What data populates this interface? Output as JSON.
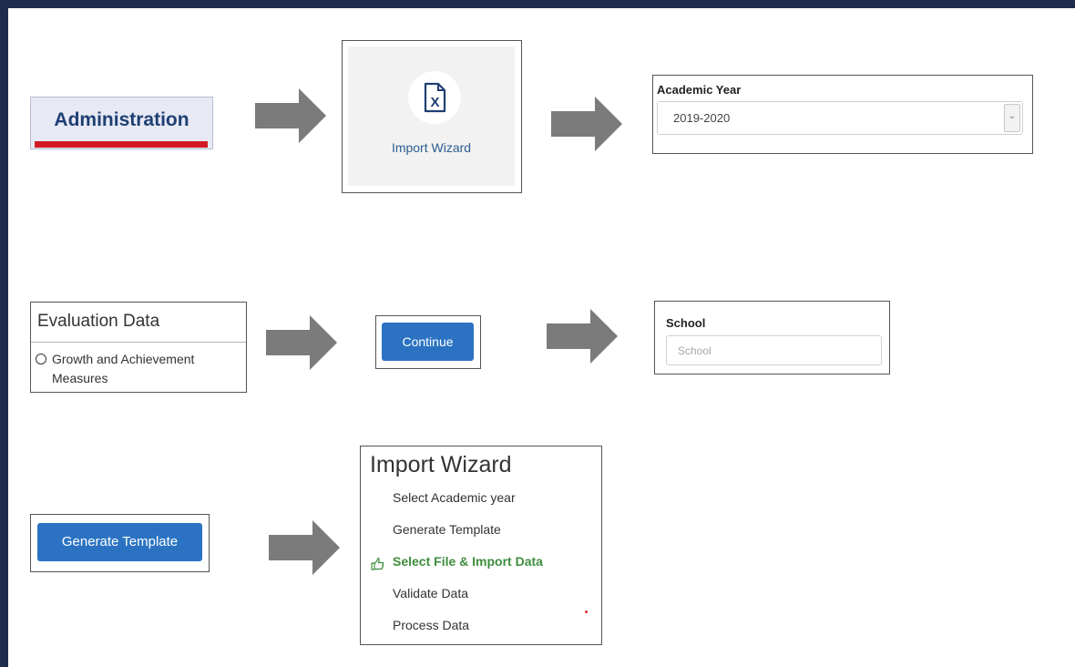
{
  "administration": {
    "label": "Administration"
  },
  "import_wizard_tile": {
    "label": "Import Wizard",
    "icon": "excel-file-icon"
  },
  "academic_year": {
    "label": "Academic Year",
    "selected": "2019-2020"
  },
  "evaluation_data": {
    "title": "Evaluation Data",
    "option": "Growth and Achievement Measures"
  },
  "continue": {
    "label": "Continue"
  },
  "school": {
    "label": "School",
    "placeholder": "School"
  },
  "generate_template": {
    "label": "Generate Template"
  },
  "import_wizard_steps": {
    "title": "Import Wizard",
    "steps": [
      {
        "label": "Select Academic year"
      },
      {
        "label": "Generate Template"
      },
      {
        "label": "Select File & Import Data",
        "current": true
      },
      {
        "label": "Validate Data"
      },
      {
        "label": "Process Data"
      }
    ]
  },
  "colors": {
    "frame": "#1f2d4d",
    "arrow": "#7b7b7b",
    "button_blue": "#2b73c2",
    "admin_red": "#d11a24",
    "current_step_green": "#3e8e3e"
  }
}
